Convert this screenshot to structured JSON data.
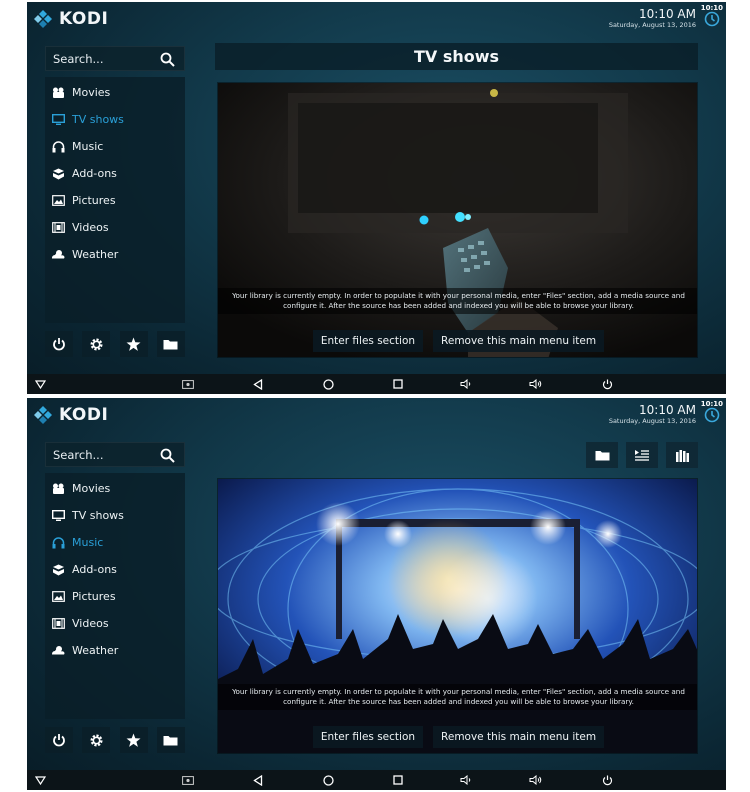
{
  "app": {
    "name": "KODI"
  },
  "status": {
    "tiny_time": "10:10"
  },
  "clock": {
    "time": "10:10 AM",
    "date": "Saturday, August 13, 2016"
  },
  "search": {
    "label": "Search..."
  },
  "menu": {
    "items": [
      {
        "label": "Movies",
        "icon": "movies-icon"
      },
      {
        "label": "TV shows",
        "icon": "tv-icon"
      },
      {
        "label": "Music",
        "icon": "headphones-icon"
      },
      {
        "label": "Add-ons",
        "icon": "addons-icon"
      },
      {
        "label": "Pictures",
        "icon": "pictures-icon"
      },
      {
        "label": "Videos",
        "icon": "film-icon"
      },
      {
        "label": "Weather",
        "icon": "weather-icon"
      }
    ]
  },
  "screen1": {
    "section_title": "TV shows",
    "selected_item": "TV shows"
  },
  "screen2": {
    "selected_item": "Music"
  },
  "library": {
    "empty_notice": "Your library is currently empty. In order to populate it with your personal media, enter \"Files\" section, add a media source and configure it. After the source has been added and indexed you will be able to browse your library.",
    "enter_files": "Enter files section",
    "remove_item": "Remove this main menu item"
  },
  "colors": {
    "accent": "#2aa0d8",
    "panel": "#0a1e28",
    "background": "#123a4b"
  }
}
